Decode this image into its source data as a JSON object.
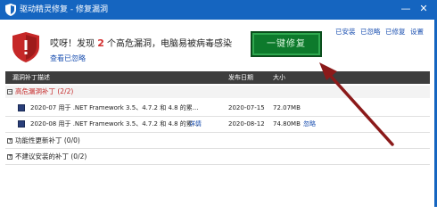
{
  "window": {
    "title": "驱动精灵修复 - 修复漏洞",
    "controls": [
      "—",
      "✕"
    ]
  },
  "summary": {
    "text_before": "哎呀！发现",
    "count": "2",
    "text_after": "个高危漏洞，电脑易被病毒感染",
    "ignored_link": "查看已忽略"
  },
  "fix_button": {
    "label": "一键修复"
  },
  "top_links": [
    "已安装",
    "已忽略",
    "已修复",
    "设置"
  ],
  "table": {
    "headers": {
      "name": "漏洞补丁描述",
      "date": "发布日期",
      "size": "大小"
    },
    "groups": [
      {
        "label": "高危漏洞补丁 (2/2)",
        "expanded": true
      },
      {
        "label": "功能性更新补丁 (0/0)",
        "expanded": false
      },
      {
        "label": "不建议安装的补丁 (0/2)",
        "expanded": false
      }
    ],
    "rows": [
      {
        "name": "2020-07 用于 .NET Framework 3.5、4.7.2 和 4.8 的累...",
        "detail": "",
        "date": "2020-07-15",
        "size": "72.07MB",
        "action": ""
      },
      {
        "name": "2020-08 用于 .NET Framework 3.5、4.7.2 和 4.8 的累...",
        "detail": "详情",
        "date": "2020-08-12",
        "size": "74.80MB",
        "action": "忽略"
      }
    ]
  },
  "colors": {
    "titlebar": "#1565c0",
    "fix_button": "#0d7a2c",
    "arrow": "#8b1a1a",
    "accent_red": "#d32f2f"
  },
  "icons": [
    "shield-icon",
    "warning-shield-icon",
    "minimize-icon",
    "close-icon",
    "checkbox-icon",
    "arrow-annotation"
  ]
}
